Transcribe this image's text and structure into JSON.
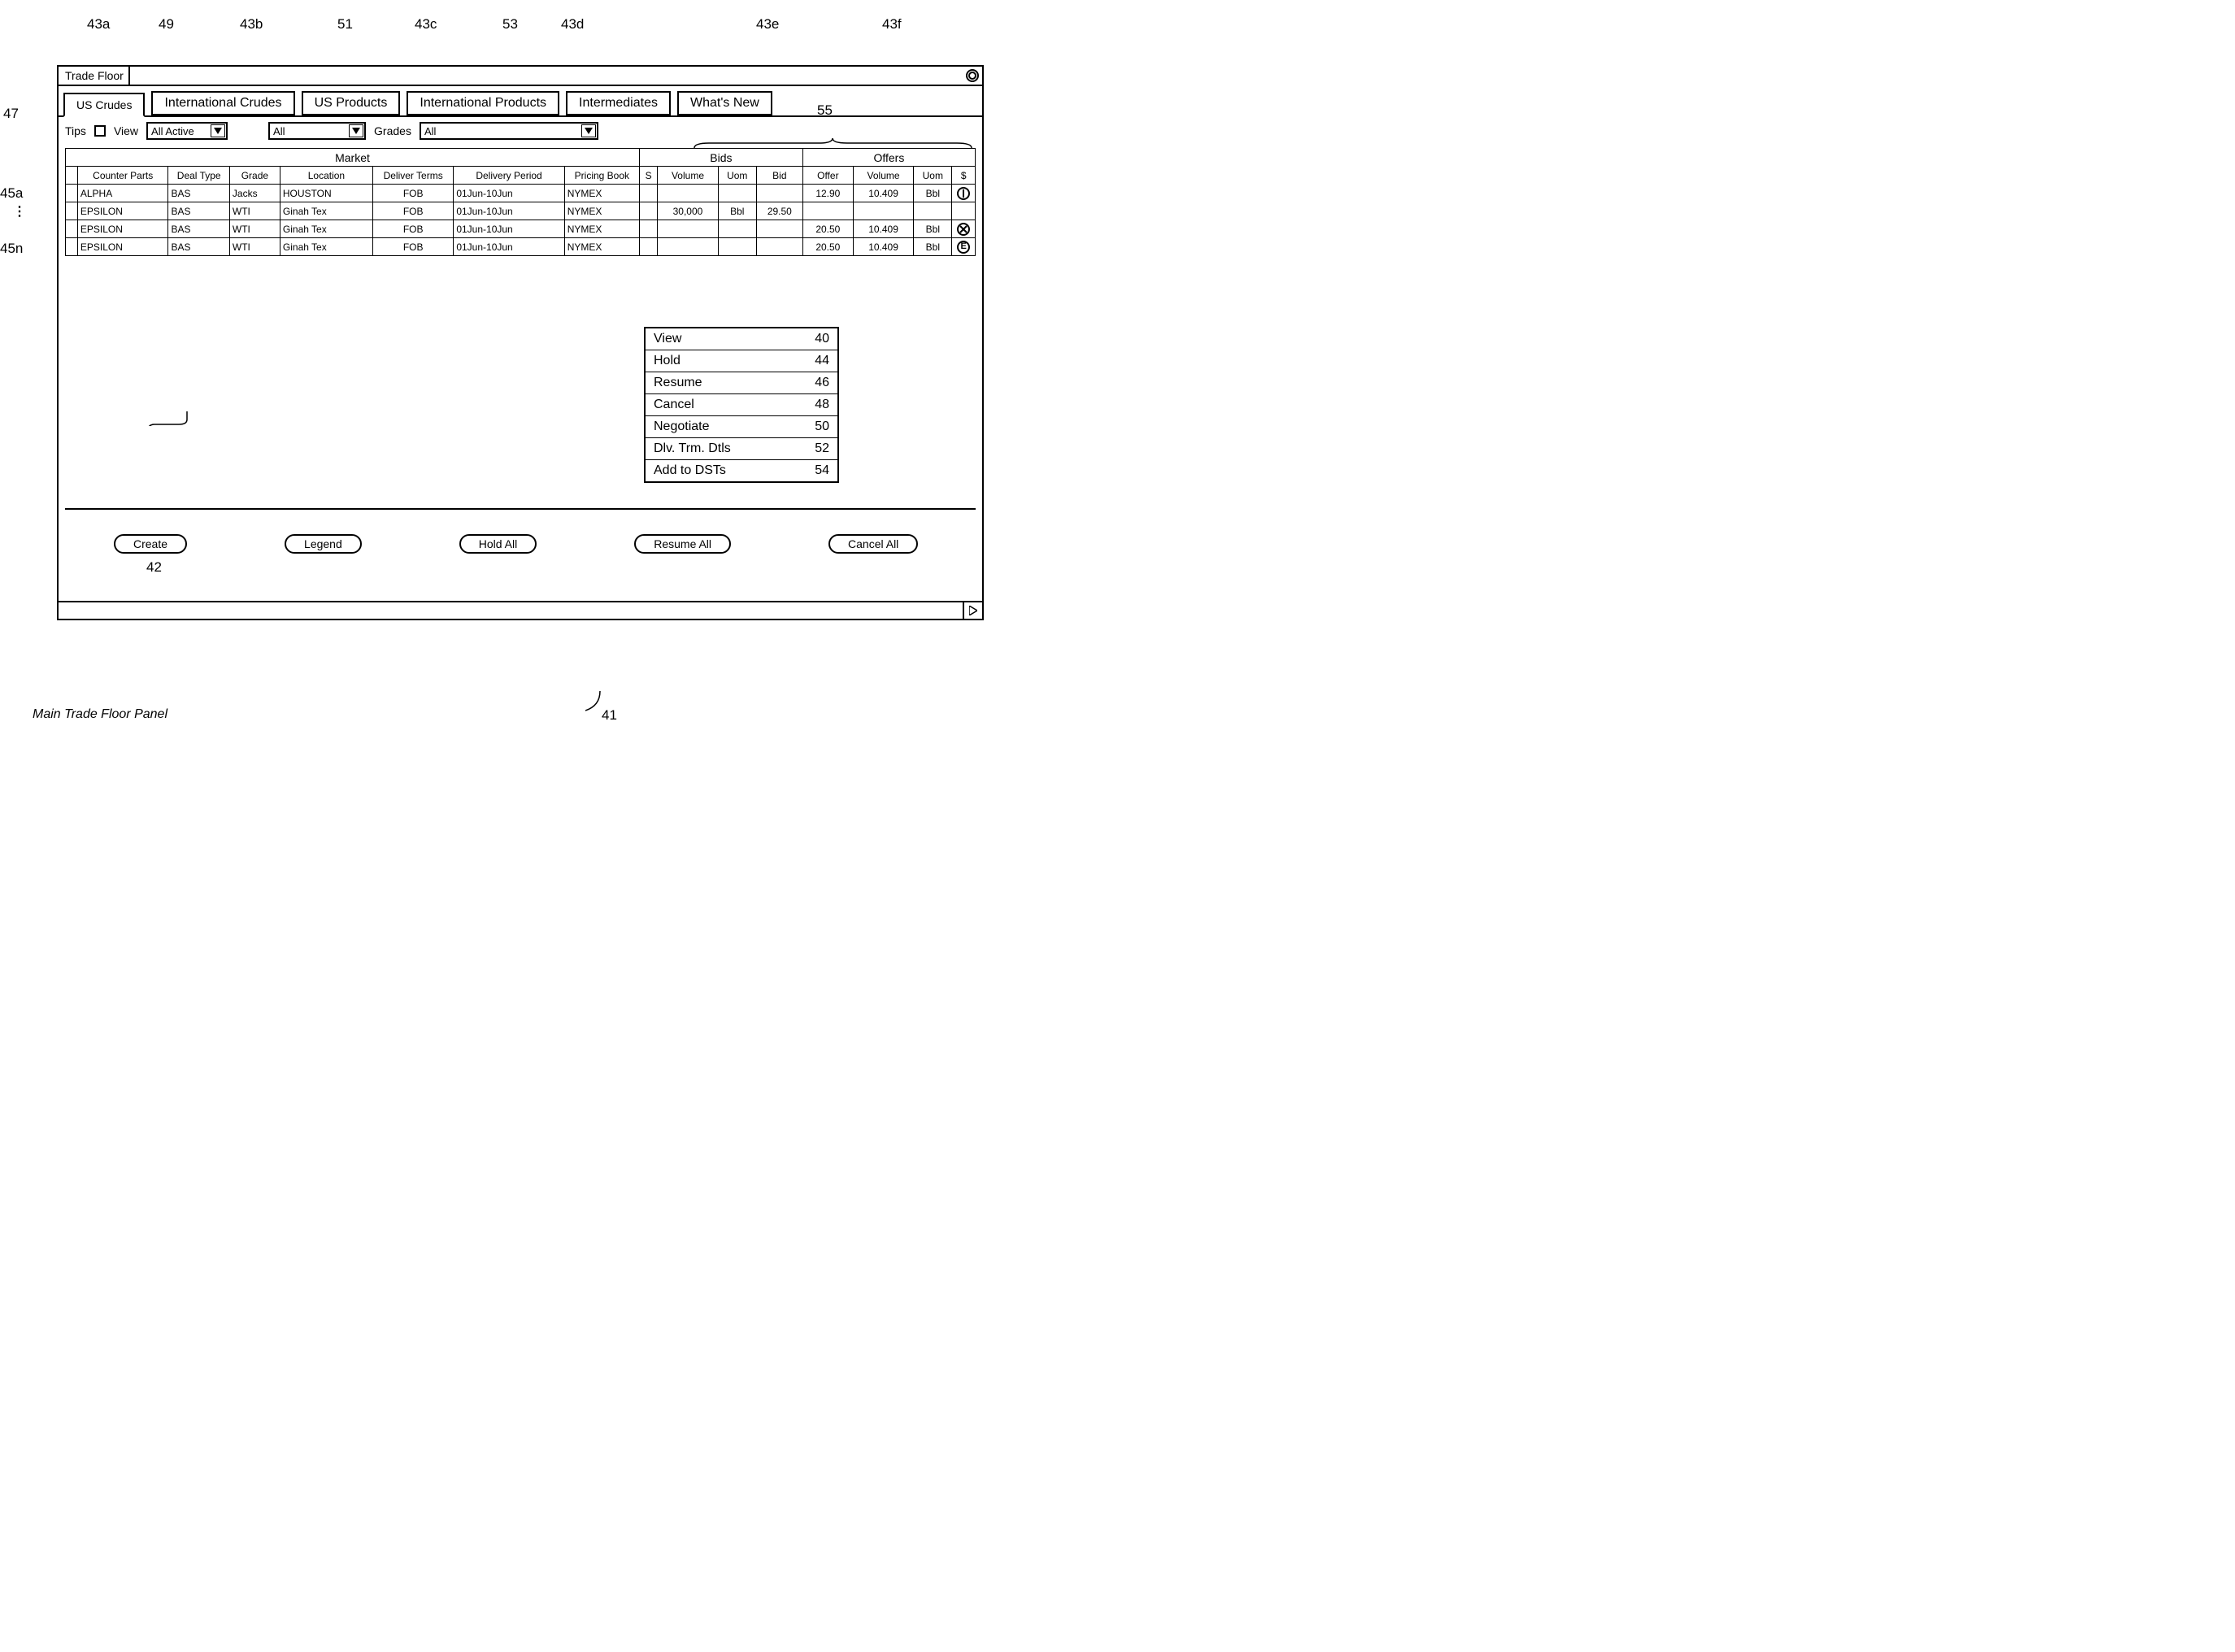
{
  "window": {
    "title": "Trade Floor"
  },
  "tabs": [
    {
      "label": "US Crudes",
      "active": true
    },
    {
      "label": "International Crudes"
    },
    {
      "label": "US Products"
    },
    {
      "label": "International Products"
    },
    {
      "label": "Intermediates"
    },
    {
      "label": "What's New"
    }
  ],
  "refs": {
    "t43a": "43a",
    "t43b": "43b",
    "t43c": "43c",
    "t43d": "43d",
    "t43e": "43e",
    "t43f": "43f",
    "t49": "49",
    "t51": "51",
    "t53": "53",
    "t47": "47",
    "t45a": "45a",
    "t45n": "45n",
    "t55": "55",
    "t42": "42",
    "t41": "41",
    "dots": "⋮"
  },
  "filters": {
    "tips_label": "Tips",
    "view_label": "View",
    "view_dd": "All Active",
    "filter2_dd": "All",
    "grades_label": "Grades",
    "grades_dd": "All"
  },
  "table": {
    "group_market": "Market",
    "group_bids": "Bids",
    "group_offers": "Offers",
    "cols": {
      "blank": "",
      "counter": "Counter Parts",
      "deal": "Deal Type",
      "grade": "Grade",
      "location": "Location",
      "terms": "Deliver Terms",
      "period": "Delivery Period",
      "book": "Pricing Book",
      "s": "S",
      "bvol": "Volume",
      "buom": "Uom",
      "bid": "Bid",
      "offer": "Offer",
      "ovol": "Volume",
      "ouom": "Uom",
      "act": "$"
    },
    "rows": [
      {
        "counter": "ALPHA",
        "deal": "BAS",
        "grade": "Jacks",
        "location": "HOUSTON",
        "terms": "FOB",
        "period": "01Jun-10Jun",
        "book": "NYMEX",
        "s": "",
        "bvol": "",
        "buom": "",
        "bid": "",
        "offer": "12.90",
        "ovol": "10.409",
        "ouom": "Bbl",
        "icon": "I"
      },
      {
        "counter": "EPSILON",
        "deal": "BAS",
        "grade": "WTI",
        "location": "Ginah Tex",
        "terms": "FOB",
        "period": "01Jun-10Jun",
        "book": "NYMEX",
        "s": "",
        "bvol": "30,000",
        "buom": "Bbl",
        "bid": "29.50",
        "offer": "",
        "ovol": "",
        "ouom": "",
        "icon": ""
      },
      {
        "counter": "EPSILON",
        "deal": "BAS",
        "grade": "WTI",
        "location": "Ginah Tex",
        "terms": "FOB",
        "period": "01Jun-10Jun",
        "book": "NYMEX",
        "s": "",
        "bvol": "",
        "buom": "",
        "bid": "",
        "offer": "20.50",
        "ovol": "10.409",
        "ouom": "Bbl",
        "icon": "X"
      },
      {
        "counter": "EPSILON",
        "deal": "BAS",
        "grade": "WTI",
        "location": "Ginah Tex",
        "terms": "FOB",
        "period": "01Jun-10Jun",
        "book": "NYMEX",
        "s": "",
        "bvol": "",
        "buom": "",
        "bid": "",
        "offer": "20.50",
        "ovol": "10.409",
        "ouom": "Bbl",
        "icon": "E"
      }
    ]
  },
  "context_menu": [
    {
      "label": "View",
      "ref": "40"
    },
    {
      "label": "Hold",
      "ref": "44"
    },
    {
      "label": "Resume",
      "ref": "46"
    },
    {
      "label": "Cancel",
      "ref": "48"
    },
    {
      "label": "Negotiate",
      "ref": "50"
    },
    {
      "label": "Dlv. Trm. Dtls",
      "ref": "52"
    },
    {
      "label": "Add to DSTs",
      "ref": "54"
    }
  ],
  "footer": {
    "create": "Create",
    "legend": "Legend",
    "hold_all": "Hold All",
    "resume_all": "Resume All",
    "cancel_all": "Cancel All"
  },
  "caption": "Main Trade Floor Panel"
}
